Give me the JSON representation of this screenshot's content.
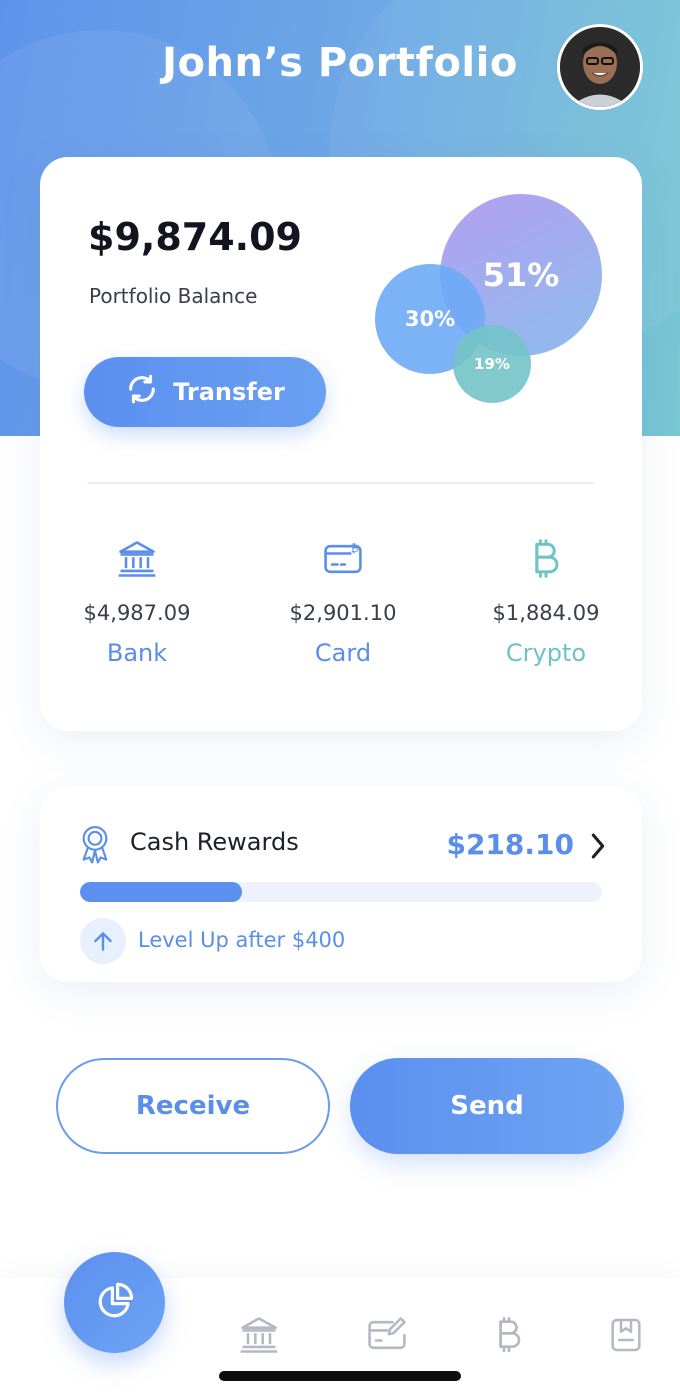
{
  "header": {
    "title": "John’s Portfolio"
  },
  "portfolio": {
    "balance": "$9,874.09",
    "balance_label": "Portfolio Balance",
    "transfer_label": "Transfer",
    "allocation": [
      {
        "label": "51%",
        "value": 51,
        "color": "#a9a6ef"
      },
      {
        "label": "30%",
        "value": 30,
        "color": "#6eaaf5"
      },
      {
        "label": "19%",
        "value": 19,
        "color": "#73c3c8"
      }
    ]
  },
  "accounts": [
    {
      "icon": "bank-icon",
      "amount": "$4,987.09",
      "name": "Bank",
      "color": "#5a8ee8"
    },
    {
      "icon": "card-icon",
      "amount": "$2,901.10",
      "name": "Card",
      "color": "#5a8ee8"
    },
    {
      "icon": "bitcoin-icon",
      "amount": "$1,884.09",
      "name": "Crypto",
      "color": "#6fc2c6"
    }
  ],
  "rewards": {
    "title": "Cash Rewards",
    "amount": "$218.10",
    "progress": 0.31,
    "level_text": "Level Up after $400",
    "icon": "award-icon"
  },
  "actions": {
    "receive_label": "Receive",
    "send_label": "Send"
  },
  "tabbar": {
    "items": [
      "pie-chart-icon",
      "bank-icon",
      "card-icon",
      "bitcoin-icon",
      "statement-icon"
    ]
  },
  "colors": {
    "accent": "#5b8ff0",
    "teal": "#6fc2c6"
  }
}
